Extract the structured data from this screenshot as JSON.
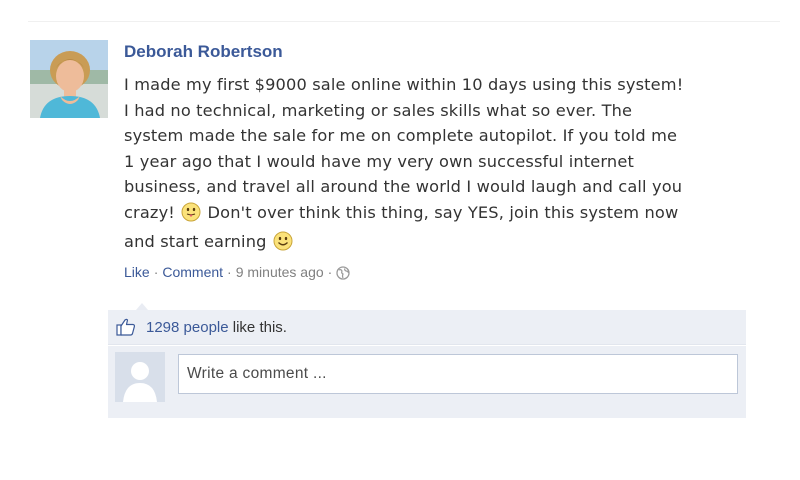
{
  "post": {
    "author": "Deborah Robertson",
    "lines": [
      "I made my first $9000 sale online within 10 days using this system!",
      "I had no technical, marketing or sales skills what so ever. The",
      "system made the sale for me on complete autopilot. If you told me",
      "1 year ago that I would have my very own successful internet",
      "business, and travel all around the world I would laugh and call you"
    ],
    "line6_start": "crazy!",
    "line6_end": "Don't over think this thing, say YES, join this system now",
    "line7": "and start earning",
    "emoji_1": "tongue-out-emoji",
    "emoji_2": "smile-emoji"
  },
  "meta": {
    "like_label": "Like",
    "comment_label": "Comment",
    "separator": "·",
    "timestamp": "9 minutes ago",
    "privacy_icon": "globe-icon"
  },
  "likes": {
    "count_link": "1298 people",
    "suffix": "like this.",
    "icon": "thumbs-up-icon"
  },
  "comment": {
    "placeholder": "Write a comment ..."
  },
  "colors": {
    "link": "#3b5998",
    "text": "#333333",
    "meta": "#808080",
    "ufi_bg": "#eceff5"
  }
}
